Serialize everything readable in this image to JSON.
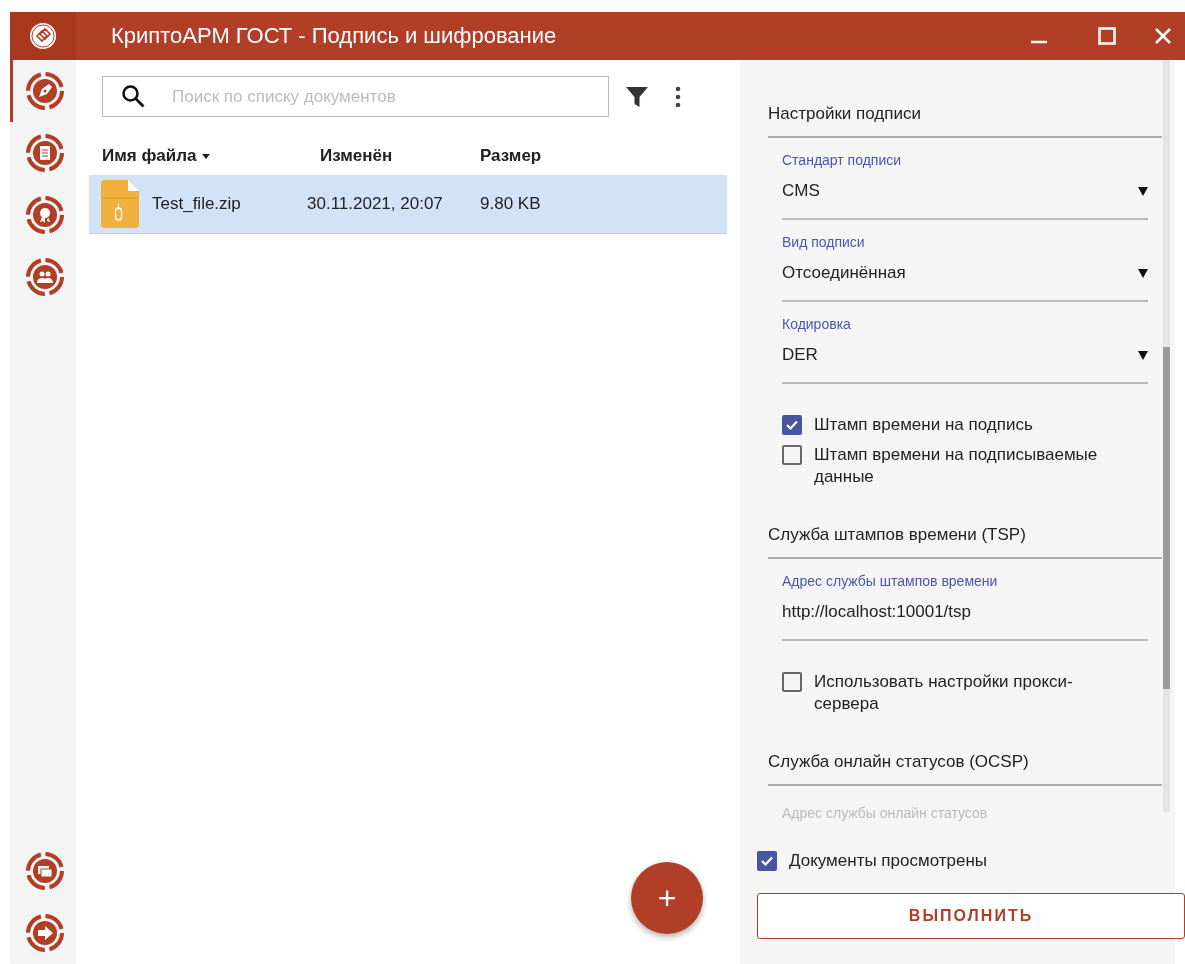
{
  "window": {
    "title": "КриптоАРМ ГОСТ - Подпись и шифрование"
  },
  "sidebar": {
    "items": [
      {
        "selected": true
      },
      {
        "selected": false
      },
      {
        "selected": false
      },
      {
        "selected": false
      }
    ]
  },
  "documents": {
    "search": {
      "placeholder": "Поиск по списку документов"
    },
    "columns": [
      {
        "label": "Имя файла",
        "sorted": true
      },
      {
        "label": "Изменён",
        "sorted": false
      },
      {
        "label": "Размер",
        "sorted": false
      }
    ],
    "rows": [
      {
        "name": "Test_file.zip",
        "modified": "30.11.2021, 20:07",
        "size": "9.80 KB",
        "selected": true
      }
    ],
    "add_button": "+"
  },
  "settings": {
    "sections": [
      {
        "title": "Настройки подписи",
        "items": [
          {
            "kind": "select",
            "label": "Стандарт подписи",
            "value": "CMS"
          },
          {
            "kind": "select",
            "label": "Вид подписи",
            "value": "Отсоединённая"
          },
          {
            "kind": "select",
            "label": "Кодировка",
            "value": "DER"
          },
          {
            "kind": "checkbox",
            "label": "Штамп времени на подпись",
            "checked": true
          },
          {
            "kind": "checkbox",
            "label": "Штамп времени на подписываемые данные",
            "checked": false
          }
        ]
      },
      {
        "title": "Служба штампов времени (TSP)",
        "items": [
          {
            "kind": "input",
            "label": "Адрес службы штампов времени",
            "value": "http://localhost:10001/tsp"
          },
          {
            "kind": "checkbox",
            "label": "Использовать настройки прокси-сервера",
            "checked": false
          }
        ]
      },
      {
        "title": "Служба онлайн статусов (OCSP)",
        "items": [
          {
            "kind": "input",
            "placeholder": "Адрес службы онлайн статусов"
          }
        ]
      }
    ]
  },
  "footer": {
    "checkbox": {
      "label": "Документы просмотрены",
      "checked": true
    },
    "button": "ВЫПОЛНИТЬ"
  }
}
